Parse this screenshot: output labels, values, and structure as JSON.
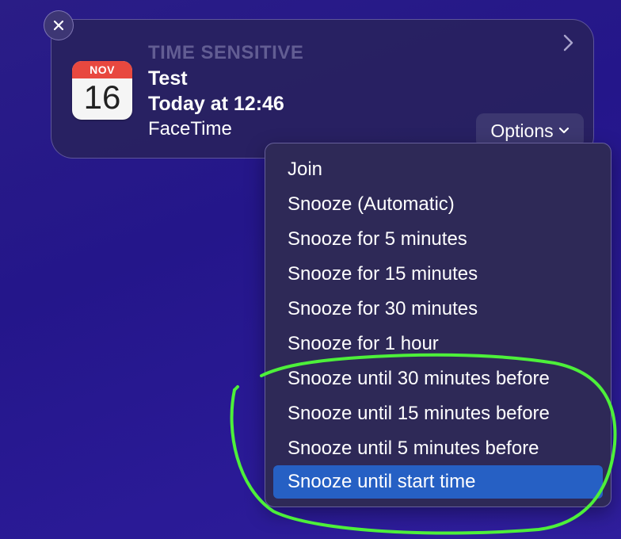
{
  "notification": {
    "category": "TIME SENSITIVE",
    "title": "Test",
    "time": "Today at 12:46",
    "app": "FaceTime",
    "calendar_icon": {
      "month": "NOV",
      "day": "16"
    },
    "options_label": "Options",
    "close_icon": "close-icon",
    "expand_icon": "chevron-right-icon"
  },
  "menu": {
    "items": [
      {
        "label": "Join"
      },
      {
        "label": "Snooze (Automatic)"
      },
      {
        "label": "Snooze for 5 minutes"
      },
      {
        "label": "Snooze for 15 minutes"
      },
      {
        "label": "Snooze for 30 minutes"
      },
      {
        "label": "Snooze for 1 hour"
      },
      {
        "label": "Snooze until 30 minutes before"
      },
      {
        "label": "Snooze until 15 minutes before"
      },
      {
        "label": "Snooze until 5 minutes before"
      },
      {
        "label": "Snooze until start time"
      }
    ],
    "selected_index": 9
  },
  "colors": {
    "background": "#24168a",
    "selection": "#2660c4",
    "annotation": "#4df03a",
    "calendar_red": "#e8483f"
  }
}
